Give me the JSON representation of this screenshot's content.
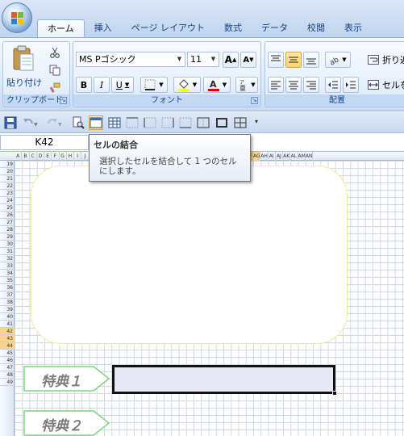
{
  "tabs": [
    "ホーム",
    "挿入",
    "ページ レイアウト",
    "数式",
    "データ",
    "校閲",
    "表示"
  ],
  "active_tab": "ホーム",
  "clipboard": {
    "paste_label": "貼り付け",
    "group_label": "クリップボード"
  },
  "font": {
    "family": "MS Pゴシック",
    "size": "11",
    "group_label": "フォント",
    "bold": "B",
    "italic": "I",
    "underline": "U",
    "grow": "A",
    "shrink": "A"
  },
  "alignment": {
    "wrap_label": "折り返",
    "merge_label": "セルを",
    "group_label": "配置"
  },
  "name_box": "K42",
  "tooltip": {
    "title": "セルの結合",
    "body": "選択したセルを結合して 1 つのセルにします。"
  },
  "columns": [
    "A",
    "B",
    "C",
    "D",
    "E",
    "F",
    "G",
    "H",
    "I",
    "J",
    "K",
    "L",
    "M",
    "N",
    "O",
    "P",
    "Q",
    "R",
    "S",
    "T",
    "U",
    "V",
    "W",
    "X",
    "Y",
    "Z",
    "AA",
    "AB",
    "AC",
    "AD",
    "AE",
    "AF",
    "AG",
    "AH",
    "AI",
    "AJ",
    "AK",
    "AL",
    "AM",
    "AN"
  ],
  "selected_columns": [
    "K",
    "L",
    "M",
    "N",
    "O",
    "P",
    "Q",
    "R",
    "S",
    "T",
    "U",
    "V",
    "W",
    "X",
    "Y",
    "Z",
    "AA",
    "AB",
    "AC",
    "AD",
    "AE",
    "AF",
    "AG"
  ],
  "rows": [
    "19",
    "20",
    "21",
    "22",
    "23",
    "24",
    "25",
    "26",
    "27",
    "28",
    "29",
    "30",
    "31",
    "32",
    "33",
    "34",
    "35",
    "36",
    "37",
    "38",
    "39",
    "40",
    "41",
    "42",
    "43",
    "44",
    "45",
    "46",
    "47",
    "48",
    "49"
  ],
  "selected_rows": [
    "42",
    "43",
    "44"
  ],
  "labels": {
    "tokuten1": "特典１",
    "tokuten2": "特典２"
  },
  "colors": {
    "selection_header": "#f8d38a",
    "arrow_outline": "#7cd67a",
    "selected_range_fill": "#e6e8f5"
  }
}
